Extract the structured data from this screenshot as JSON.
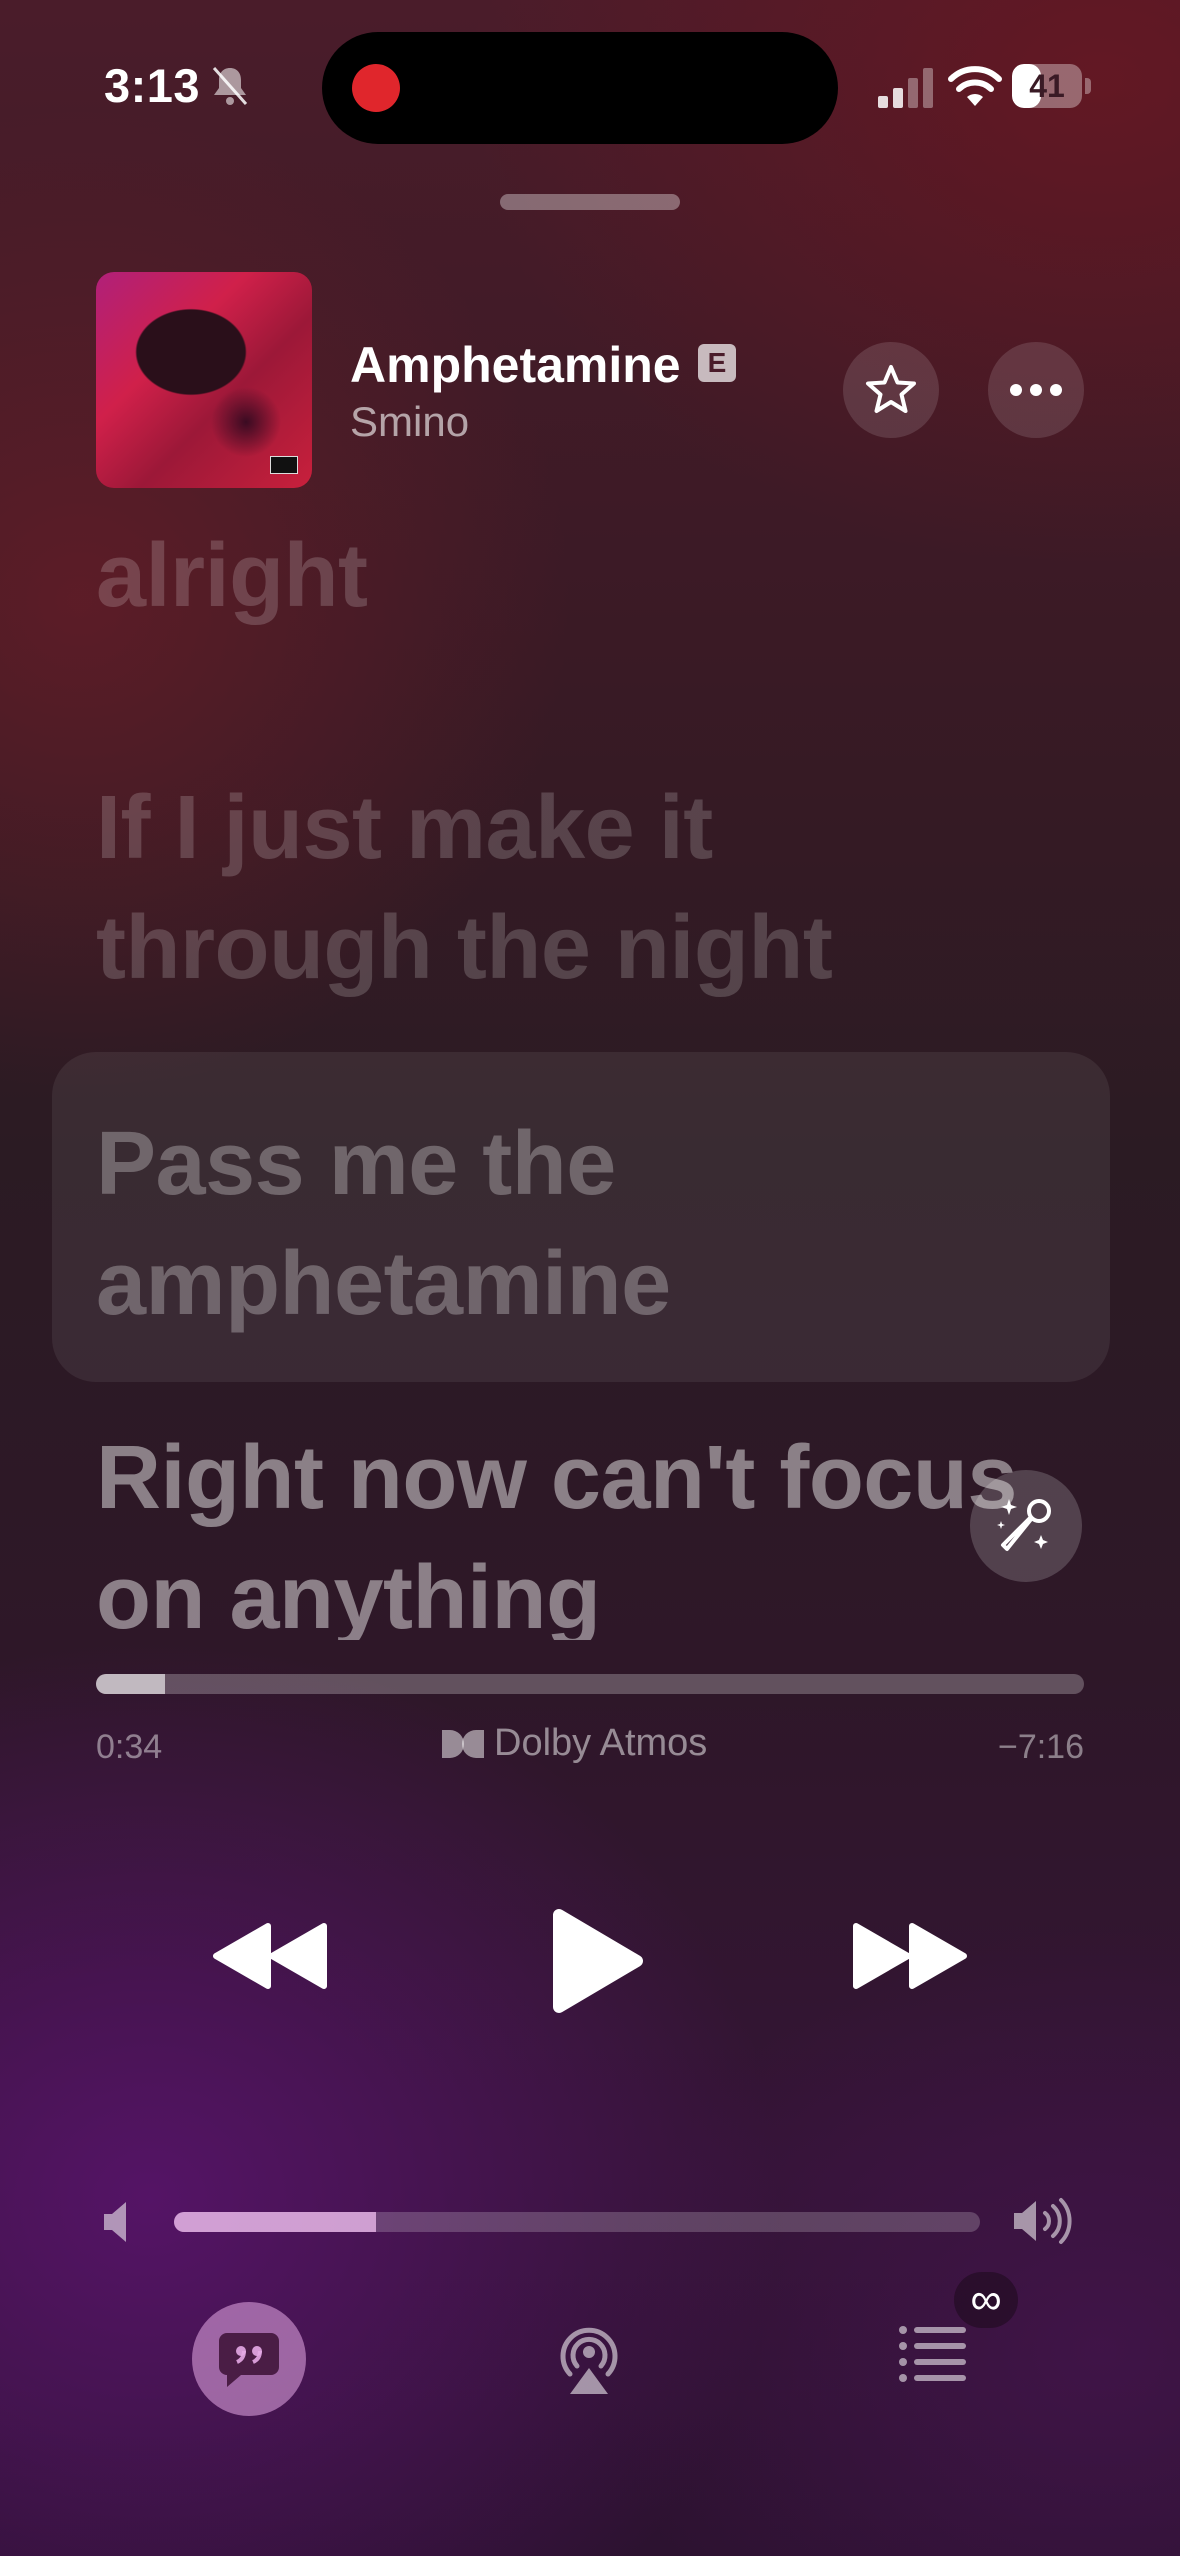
{
  "status_bar": {
    "time": "3:13",
    "battery": "41",
    "battery_level": 0.41,
    "icons": [
      "bell-muted-icon",
      "recording-dot-icon",
      "cellular-signal-icon",
      "wifi-icon",
      "battery-icon"
    ]
  },
  "now_playing": {
    "title": "Amphetamine",
    "explicit_label": "E",
    "artist": "Smino",
    "artwork_icon": "album-artwork",
    "favorite_icon": "star-icon",
    "more_icon": "ellipsis-icon"
  },
  "lyrics": {
    "lines": [
      "Got no doubt I'll be alright",
      "If I just make it through the night",
      "Pass me the amphetamine",
      "Right now can't focus on anything"
    ],
    "active_index": 2,
    "sing_icon": "magic-microphone-icon"
  },
  "playback": {
    "elapsed": "0:34",
    "remaining": "−7:16",
    "progress": 0.07,
    "format_label": "Dolby Atmos",
    "format_icon": "dolby-icon",
    "controls": [
      "rewind-icon",
      "play-icon",
      "fast-forward-icon"
    ]
  },
  "volume": {
    "level": 0.25,
    "low_icon": "speaker-low-icon",
    "high_icon": "speaker-high-icon"
  },
  "bottom_bar": {
    "lyrics_icon": "lyrics-quote-icon",
    "airplay_icon": "airplay-audio-icon",
    "queue_icon": "queue-list-icon",
    "autoplay_badge": "∞"
  },
  "colors": {
    "background_top": "#4a1c2a",
    "background_bottom": "#341436",
    "accent": "#e6aae6",
    "record": "#e0262c"
  }
}
